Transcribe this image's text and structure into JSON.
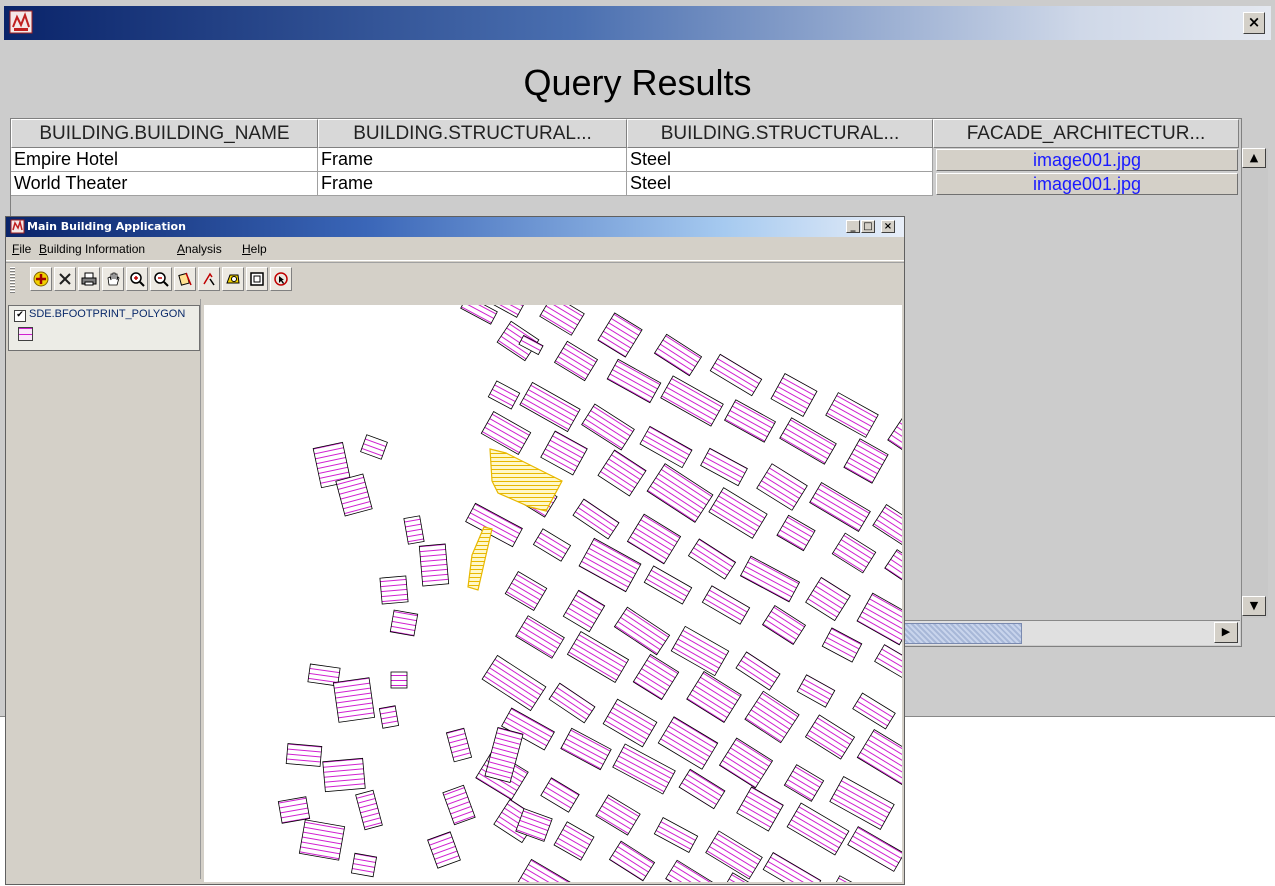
{
  "query_results": {
    "heading": "Query Results",
    "close_glyph": "×",
    "columns": [
      "BUILDING.BUILDING_NAME",
      "BUILDING.STRUCTURAL...",
      "BUILDING.STRUCTURAL...",
      "FACADE_ARCHITECTUR..."
    ],
    "rows": [
      {
        "name": "Empire Hotel",
        "structural_1": "Frame",
        "structural_2": "Steel",
        "facade": "image001.jpg"
      },
      {
        "name": "World Theater",
        "structural_1": "Frame",
        "structural_2": "Steel",
        "facade": "image001.jpg"
      }
    ],
    "scroll_glyphs": {
      "up": "▲",
      "down": "▼",
      "right": "▶"
    }
  },
  "main_app": {
    "title": "Main Building Application",
    "window_buttons": {
      "minimize": "_",
      "maximize": "□",
      "close": "×"
    },
    "menus": [
      {
        "mnemonic": "F",
        "rest": "ile"
      },
      {
        "mnemonic": "B",
        "rest": "uilding Information"
      },
      {
        "mnemonic": "A",
        "rest": "nalysis"
      },
      {
        "mnemonic": "H",
        "rest": "elp"
      }
    ],
    "toolbar_icons": [
      "add-layer-icon",
      "delete-icon",
      "print-icon",
      "pan-hand-icon",
      "zoom-in-icon",
      "zoom-out-icon",
      "identify-icon",
      "select-icon",
      "query-icon",
      "full-extent-icon",
      "pointer-icon"
    ],
    "legend": {
      "checked": true,
      "check_glyph": "✔",
      "layer_name": "SDE.BFOOTPRINT_POLYGON"
    },
    "colors": {
      "building_hatch": "#d020d0",
      "selected_hatch": "#e8b800",
      "title_bar": "#0a246a"
    }
  }
}
